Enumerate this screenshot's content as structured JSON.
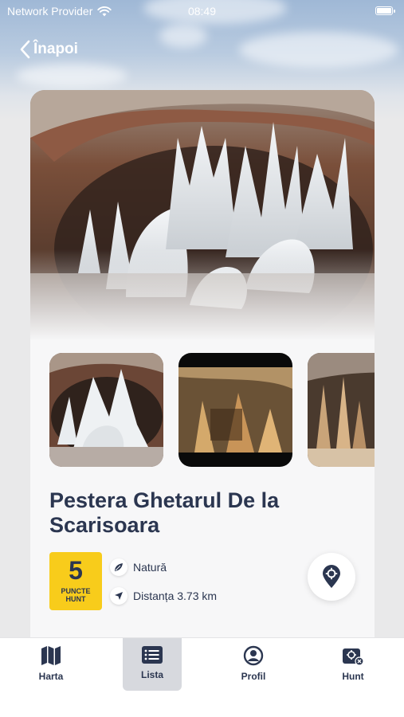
{
  "status_bar": {
    "provider": "Network Provider",
    "time": "08:49"
  },
  "nav": {
    "back_label": "Înapoi"
  },
  "place": {
    "title": "Pestera Ghetarul De la Scarisoara",
    "points_value": "5",
    "points_label_line1": "PUNCTE",
    "points_label_line2": "HUNT",
    "category": "Natură",
    "distance": "Distanța 3.73 km"
  },
  "gallery": {
    "images": [
      "ice-cave-photo",
      "cave-stalactites-photo",
      "cave-stalagmites-photo"
    ]
  },
  "tab_bar": {
    "tabs": [
      {
        "label": "Harta",
        "icon": "map-icon"
      },
      {
        "label": "Lista",
        "icon": "list-icon"
      },
      {
        "label": "Profil",
        "icon": "profile-icon"
      },
      {
        "label": "Hunt",
        "icon": "hunt-icon"
      }
    ],
    "active": "Lista"
  },
  "colors": {
    "accent": "#2b3650",
    "badge": "#f8cc1b",
    "card": "#f7f7f8"
  }
}
